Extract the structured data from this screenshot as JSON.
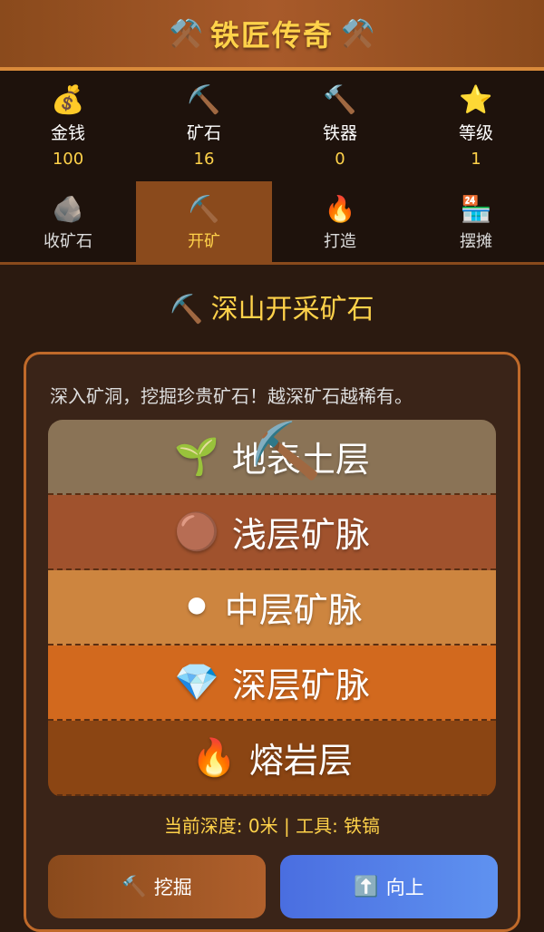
{
  "header": {
    "title": "铁匠传奇",
    "left_icon": "⚒️",
    "right_icon": "⚒️"
  },
  "stats": [
    {
      "icon": "💰",
      "label": "金钱",
      "value": "100"
    },
    {
      "icon": "⛏️",
      "label": "矿石",
      "value": "16"
    },
    {
      "icon": "🔨",
      "label": "铁器",
      "value": "0"
    },
    {
      "icon": "⭐",
      "label": "等级",
      "value": "1"
    }
  ],
  "tabs": [
    {
      "icon": "🪨",
      "label": "收矿石",
      "active": false
    },
    {
      "icon": "⛏️",
      "label": "开矿",
      "active": true
    },
    {
      "icon": "🔥",
      "label": "打造",
      "active": false
    },
    {
      "icon": "🏪",
      "label": "摆摊",
      "active": false
    }
  ],
  "section": {
    "icon": "⛏️",
    "title": "深山开采矿石"
  },
  "panel": {
    "description": "深入矿洞，挖掘珍贵矿石！越深矿石越稀有。",
    "layers": [
      {
        "icon": "🌱",
        "label": "地表土层",
        "color": "#8a7356"
      },
      {
        "icon": "🟤",
        "label": "浅层矿脉",
        "color": "#a0522d"
      },
      {
        "icon": "⚫",
        "label": "中层矿脉",
        "color": "#cd853f"
      },
      {
        "icon": "💎",
        "label": "深层矿脉",
        "color": "#d2691e"
      },
      {
        "icon": "🔥",
        "label": "熔岩层",
        "color": "#8b4513"
      }
    ],
    "pickaxe_icon": "⛏️",
    "depth_text": "当前深度: 0米 | 工具: 铁镐",
    "buttons": {
      "dig": {
        "icon": "🔨",
        "label": "挖掘"
      },
      "up": {
        "icon": "⬆️",
        "label": "向上"
      }
    }
  }
}
